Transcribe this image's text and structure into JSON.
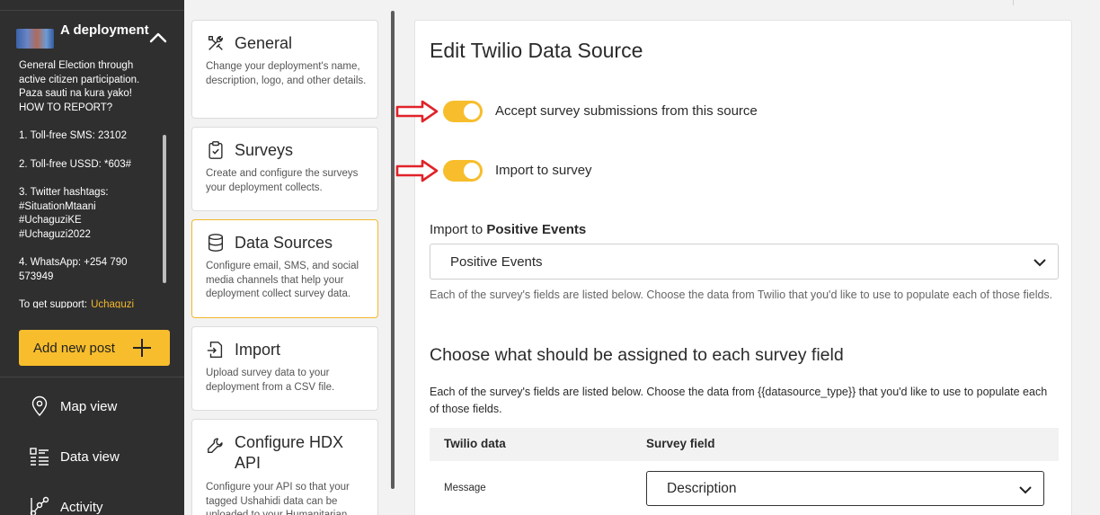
{
  "sidebar": {
    "deployment_title": "A deployment",
    "description": [
      "General Election through active citizen participation. Paza sauti na kura yako!\nHOW TO REPORT?",
      "1. Toll-free SMS: 23102",
      "2. Toll-free USSD: *603#",
      "3. Twitter hashtags:\n#SituationMtaani\n#UchaguziKE\n#Uchaguzi2022",
      "4. WhatsApp: +254 790 573949"
    ],
    "support_text": "To get support:",
    "support_link": "Uchaguzi",
    "add_post_label": "Add new post",
    "nav": [
      {
        "label": "Map view",
        "icon": "map-pin-icon"
      },
      {
        "label": "Data view",
        "icon": "list-icon"
      },
      {
        "label": "Activity",
        "icon": "activity-icon"
      }
    ]
  },
  "settings": {
    "items": [
      {
        "title": "General",
        "desc": "Change your deployment's name, description, logo, and other details.",
        "icon": "tools-icon"
      },
      {
        "title": "Surveys",
        "desc": "Create and configure the surveys your deployment collects.",
        "icon": "clipboard-check-icon"
      },
      {
        "title": "Data Sources",
        "desc": "Configure email, SMS, and social media channels that help your deployment collect survey data.",
        "icon": "database-icon"
      },
      {
        "title": "Import",
        "desc": "Upload survey data to your deployment from a CSV file.",
        "icon": "import-icon"
      },
      {
        "title": "Configure HDX API",
        "desc": "Configure your API so that your tagged Ushahidi data can be uploaded to your Humanitarian",
        "icon": "wrench-icon"
      }
    ]
  },
  "main": {
    "title": "Edit Twilio Data Source",
    "toggle_accept": "Accept survey submissions from this source",
    "toggle_import": "Import to survey",
    "import_to_prefix": "Import to",
    "import_to_survey": "Positive Events",
    "survey_select_value": "Positive Events",
    "help_1": "Each of the survey's fields are listed below. Choose the data from Twilio that you'd like to use to populate each of those fields.",
    "section_title": "Choose what should be assigned to each survey field",
    "help_2": "Each of the survey's fields are listed below. Choose the data from {{datasource_type}} that you'd like to use to populate each of those fields.",
    "table": {
      "col_source": "Twilio data",
      "col_field": "Survey field",
      "rows": [
        {
          "source": "Message",
          "field": "Description"
        }
      ]
    }
  },
  "colors": {
    "accent": "#f7bd2c",
    "sidebar_bg": "#2f2f2f",
    "annotation_arrow": "#e0232a"
  }
}
